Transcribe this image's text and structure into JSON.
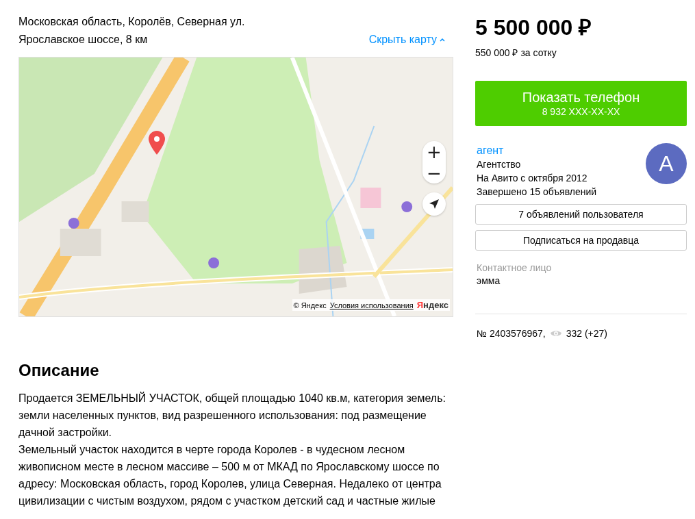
{
  "address": {
    "line": "Московская область, Королёв, Северная ул.",
    "highway": "Ярославское шоссе, 8 км",
    "toggle": "Скрыть карту"
  },
  "map": {
    "attribution": "© Яндекс",
    "terms_link": "Условия использования",
    "logo": "Яндекс",
    "zoom_in": "+",
    "zoom_out": "−"
  },
  "description": {
    "title": "Описание",
    "paragraphs": [
      "Продается ЗЕМЕЛЬНЫЙ УЧАСТОК, общей площадью 1040 кв.м, категория земель: земли населенных пунктов, вид разрешенного использования: под размещение дачной застройки.",
      "Земельный участок находится в черте города Королев - в чудесном лесном живописном месте в лесном массиве – 500 м от МКАД по Ярославскому шоссе по адресу: Московская область, город Королев, улица Северная. Недалеко от центра цивилизации с чистым воздухом, рядом с участком детский сад и частные жилые"
    ]
  },
  "price": {
    "total": "5 500 000 ₽",
    "per_unit": "550 000 ₽ за сотку"
  },
  "phone_button": {
    "label": "Показать телефон",
    "number": "8 932 XXX-XX-XX"
  },
  "seller": {
    "name": "агент",
    "type": "Агентство",
    "since": "На Авито с октября 2012",
    "completed": "Завершено 15 объявлений",
    "avatar": "А"
  },
  "seller_buttons": [
    "7 объявлений пользователя",
    "Подписаться на продавца"
  ],
  "contact": {
    "label": "Контактное лицо",
    "name": "эмма"
  },
  "listing": {
    "number": "№ 2403576967,",
    "views": "332 (+27)"
  }
}
